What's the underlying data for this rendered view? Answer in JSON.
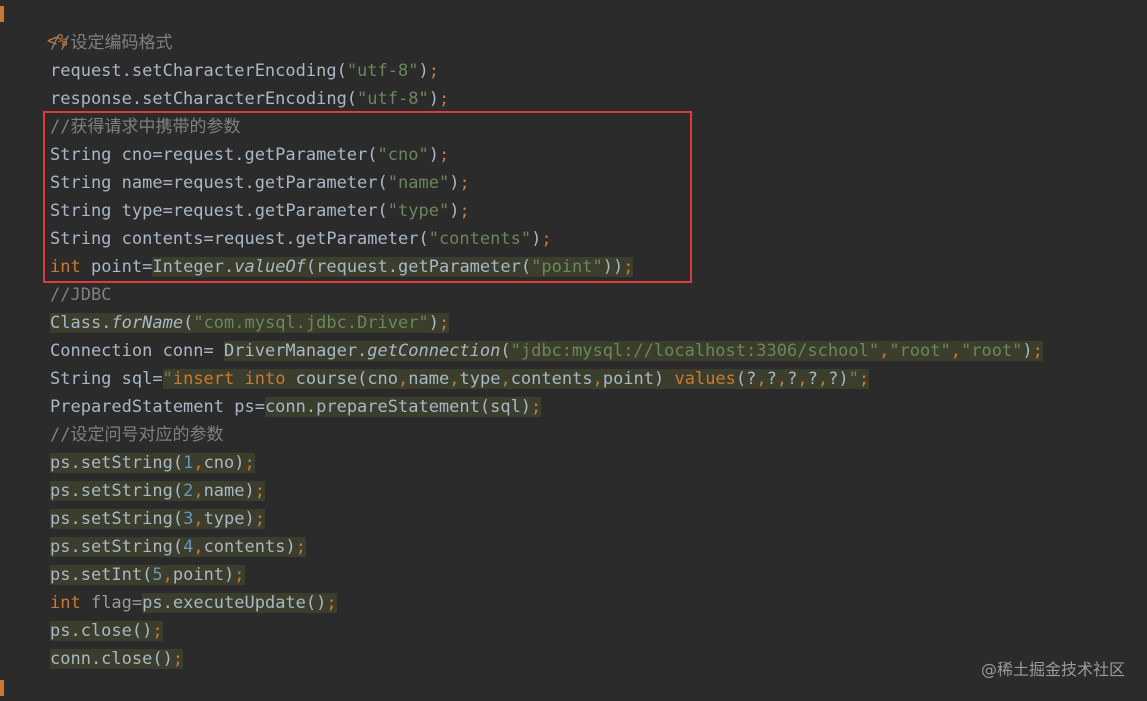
{
  "open_tag": "<%",
  "close_tag": "%>",
  "lines": [
    {
      "highlight": false,
      "tokens": [
        [
          "cmt",
          "//设定编码格式"
        ]
      ]
    },
    {
      "highlight": false,
      "tokens": [
        [
          "id",
          "request.setCharacterEncoding("
        ],
        [
          "str",
          "\"utf-8\""
        ],
        [
          "id",
          ")"
        ],
        [
          "kw",
          ";"
        ]
      ]
    },
    {
      "highlight": false,
      "tokens": [
        [
          "id",
          "response.setCharacterEncoding("
        ],
        [
          "str",
          "\"utf-8\""
        ],
        [
          "id",
          ")"
        ],
        [
          "kw",
          ";"
        ]
      ]
    },
    {
      "highlight": false,
      "tokens": [
        [
          "cmt",
          "//获得请求中携带的参数"
        ]
      ]
    },
    {
      "highlight": false,
      "tokens": [
        [
          "id",
          "String cno=request.getParameter("
        ],
        [
          "str",
          "\"cno\""
        ],
        [
          "id",
          ")"
        ],
        [
          "kw",
          ";"
        ]
      ]
    },
    {
      "highlight": false,
      "tokens": [
        [
          "id",
          "String name=request.getParameter("
        ],
        [
          "str",
          "\"name\""
        ],
        [
          "id",
          ")"
        ],
        [
          "kw",
          ";"
        ]
      ]
    },
    {
      "highlight": false,
      "tokens": [
        [
          "id",
          "String type=request.getParameter("
        ],
        [
          "str",
          "\"type\""
        ],
        [
          "id",
          ")"
        ],
        [
          "kw",
          ";"
        ]
      ]
    },
    {
      "highlight": false,
      "tokens": [
        [
          "id",
          "String contents=request.getParameter("
        ],
        [
          "str",
          "\"contents\""
        ],
        [
          "id",
          ")"
        ],
        [
          "kw",
          ";"
        ]
      ]
    },
    {
      "highlight": true,
      "hl_from": 2,
      "tokens": [
        [
          "kw",
          "int"
        ],
        [
          "id",
          " point="
        ],
        [
          "id",
          "Integer."
        ],
        [
          "ital",
          "valueOf"
        ],
        [
          "id",
          "(request.getParameter("
        ],
        [
          "str",
          "\"point\""
        ],
        [
          "id",
          "))"
        ],
        [
          "kw",
          ";"
        ]
      ]
    },
    {
      "highlight": false,
      "tokens": [
        [
          "cmt",
          "//JDBC"
        ]
      ]
    },
    {
      "highlight": true,
      "tokens": [
        [
          "id",
          "Class."
        ],
        [
          "ital",
          "forName"
        ],
        [
          "id",
          "("
        ],
        [
          "str",
          "\"com.mysql.jdbc.Driver\""
        ],
        [
          "id",
          ")"
        ],
        [
          "kw",
          ";"
        ]
      ]
    },
    {
      "highlight": true,
      "hl_from": 1,
      "tokens": [
        [
          "id",
          "Connection conn= "
        ],
        [
          "id",
          "DriverManager."
        ],
        [
          "ital",
          "getConnection"
        ],
        [
          "id",
          "("
        ],
        [
          "str",
          "\"jdbc:mysql://localhost:3306/school\""
        ],
        [
          "kw",
          ","
        ],
        [
          "str",
          "\"root\""
        ],
        [
          "kw",
          ","
        ],
        [
          "str",
          "\"root\""
        ],
        [
          "id",
          ")"
        ],
        [
          "kw",
          ";"
        ]
      ]
    },
    {
      "highlight": true,
      "hl_from": 1,
      "tokens": [
        [
          "id",
          "String sql="
        ],
        [
          "str",
          "\""
        ],
        [
          "kw",
          "insert into "
        ],
        [
          "id",
          "course(cno"
        ],
        [
          "kw",
          ","
        ],
        [
          "id",
          "name"
        ],
        [
          "kw",
          ","
        ],
        [
          "id",
          "type"
        ],
        [
          "kw",
          ","
        ],
        [
          "id",
          "contents"
        ],
        [
          "kw",
          ","
        ],
        [
          "id",
          "point) "
        ],
        [
          "kw",
          "values"
        ],
        [
          "id",
          "(?"
        ],
        [
          "kw",
          ","
        ],
        [
          "id",
          "?"
        ],
        [
          "kw",
          ","
        ],
        [
          "id",
          "?"
        ],
        [
          "kw",
          ","
        ],
        [
          "id",
          "?"
        ],
        [
          "kw",
          ","
        ],
        [
          "id",
          "?)"
        ],
        [
          "str",
          "\""
        ],
        [
          "kw",
          ";"
        ]
      ]
    },
    {
      "highlight": true,
      "hl_from": 1,
      "tokens": [
        [
          "id",
          "PreparedStatement ps="
        ],
        [
          "id",
          "conn.prepareStatement(sql)"
        ],
        [
          "kw",
          ";"
        ]
      ]
    },
    {
      "highlight": false,
      "tokens": [
        [
          "cmt",
          "//设定问号对应的参数"
        ]
      ]
    },
    {
      "highlight": true,
      "tokens": [
        [
          "id",
          "ps.setString("
        ],
        [
          "num",
          "1"
        ],
        [
          "kw",
          ","
        ],
        [
          "id",
          "cno)"
        ],
        [
          "kw",
          ";"
        ]
      ]
    },
    {
      "highlight": true,
      "tokens": [
        [
          "id",
          "ps.setString("
        ],
        [
          "num",
          "2"
        ],
        [
          "kw",
          ","
        ],
        [
          "id",
          "name)"
        ],
        [
          "kw",
          ";"
        ]
      ]
    },
    {
      "highlight": true,
      "tokens": [
        [
          "id",
          "ps.setString("
        ],
        [
          "num",
          "3"
        ],
        [
          "kw",
          ","
        ],
        [
          "id",
          "type)"
        ],
        [
          "kw",
          ";"
        ]
      ]
    },
    {
      "highlight": true,
      "tokens": [
        [
          "id",
          "ps.setString("
        ],
        [
          "num",
          "4"
        ],
        [
          "kw",
          ","
        ],
        [
          "id",
          "contents)"
        ],
        [
          "kw",
          ";"
        ]
      ]
    },
    {
      "highlight": true,
      "tokens": [
        [
          "id",
          "ps.setInt("
        ],
        [
          "num",
          "5"
        ],
        [
          "kw",
          ","
        ],
        [
          "id",
          "point)"
        ],
        [
          "kw",
          ";"
        ]
      ]
    },
    {
      "highlight": true,
      "hl_from": 2,
      "tokens": [
        [
          "kw",
          "int "
        ],
        [
          "muted",
          "flag="
        ],
        [
          "id",
          "ps.executeUpdate()"
        ],
        [
          "kw",
          ";"
        ]
      ]
    },
    {
      "highlight": true,
      "tokens": [
        [
          "id",
          "ps.close()"
        ],
        [
          "kw",
          ";"
        ]
      ]
    },
    {
      "highlight": true,
      "tokens": [
        [
          "id",
          "conn.close()"
        ],
        [
          "kw",
          ";"
        ]
      ]
    }
  ],
  "watermark": "@稀土掘金技术社区",
  "colors": {
    "background": "#2b2b2b",
    "keyword": "#cc7832",
    "string": "#6a8759",
    "comment": "#808080",
    "number": "#6897bb",
    "identifier": "#a9b7c6",
    "selection_box": "#e03a3e"
  }
}
